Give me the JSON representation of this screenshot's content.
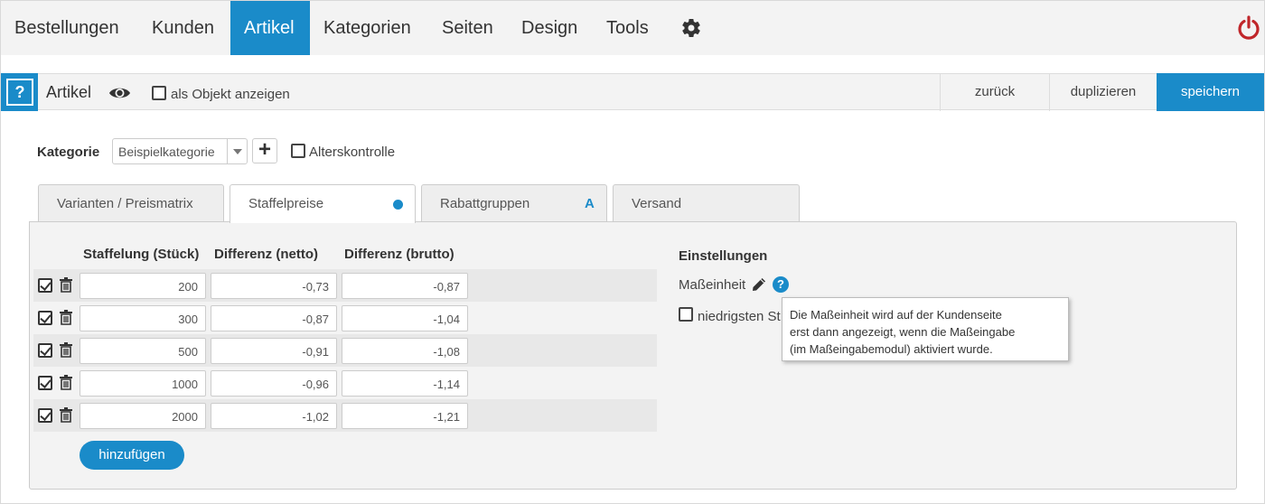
{
  "nav": {
    "items": [
      {
        "label": "Bestellungen",
        "active": false
      },
      {
        "label": "Kunden",
        "active": false
      },
      {
        "label": "Artikel",
        "active": true
      },
      {
        "label": "Kategorien",
        "active": false
      },
      {
        "label": "Seiten",
        "active": false
      },
      {
        "label": "Design",
        "active": false
      },
      {
        "label": "Tools",
        "active": false
      }
    ],
    "settings_icon": "gear-icon",
    "logout_icon": "power-icon"
  },
  "toolbar": {
    "help_label": "?",
    "title": "Artikel",
    "preview_icon": "eye-icon",
    "object_view_label": "als Objekt anzeigen",
    "object_view_checked": false,
    "back_label": "zurück",
    "duplicate_label": "duplizieren",
    "save_label": "speichern"
  },
  "category": {
    "label": "Kategorie",
    "selected": "Beispielkategorie",
    "add_label": "+",
    "age_check_label": "Alterskontrolle",
    "age_check_checked": false
  },
  "tabs": [
    {
      "label": "Varianten / Preismatrix",
      "active": false
    },
    {
      "label": "Staffelpreise",
      "active": true,
      "indicator": "dot"
    },
    {
      "label": "Rabattgruppen",
      "active": false,
      "badge": "A"
    },
    {
      "label": "Versand",
      "active": false
    }
  ],
  "table": {
    "headers": [
      "Staffelung (Stück)",
      "Differenz (netto)",
      "Differenz (brutto)"
    ],
    "rows": [
      {
        "qty": "200",
        "net": "-0,73",
        "gross": "-0,87",
        "checked": true
      },
      {
        "qty": "300",
        "net": "-0,87",
        "gross": "-1,04",
        "checked": true
      },
      {
        "qty": "500",
        "net": "-0,91",
        "gross": "-1,08",
        "checked": true
      },
      {
        "qty": "1000",
        "net": "-0,96",
        "gross": "-1,14",
        "checked": true
      },
      {
        "qty": "2000",
        "net": "-1,02",
        "gross": "-1,21",
        "checked": true
      }
    ],
    "add_label": "hinzufügen"
  },
  "settings": {
    "title": "Einstellungen",
    "unit_label": "Maßeinheit",
    "lowest_label": "niedrigsten St",
    "lowest_checked": false,
    "tooltip_lines": [
      "Die Maßeinheit wird auf der Kundenseite",
      "erst dann angezeigt, wenn die Maßeingabe",
      "(im Maßeingabemodul) aktiviert wurde."
    ]
  },
  "colors": {
    "accent": "#1a8bc9",
    "power": "#c0262a"
  }
}
